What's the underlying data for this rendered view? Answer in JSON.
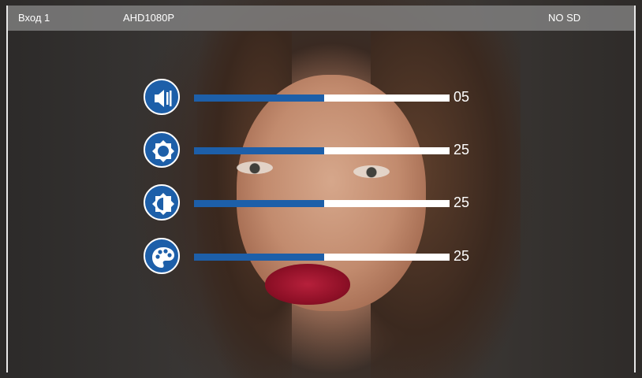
{
  "status_bar": {
    "input_label": "Вход 1",
    "format_label": "AHD1080P",
    "sd_status": "NO SD"
  },
  "controls": [
    {
      "id": "volume",
      "icon": "speaker-icon",
      "value_text": "05",
      "level_fraction": 0.51
    },
    {
      "id": "brightness",
      "icon": "sun-icon",
      "value_text": "25",
      "level_fraction": 0.51
    },
    {
      "id": "contrast",
      "icon": "contrast-icon",
      "value_text": "25",
      "level_fraction": 0.51
    },
    {
      "id": "color",
      "icon": "palette-icon",
      "value_text": "25",
      "level_fraction": 0.51
    }
  ],
  "colors": {
    "accent": "#1d5fa9",
    "track": "#ffffff",
    "status_bar_bg": "#8c8c8c"
  }
}
